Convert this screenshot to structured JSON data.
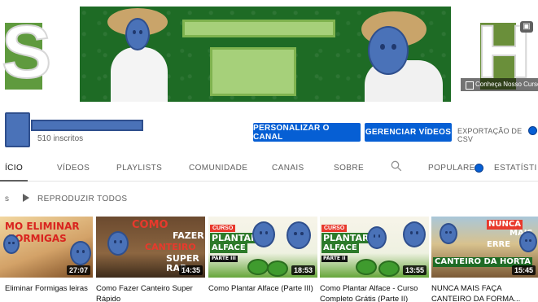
{
  "banner": {
    "left_letter": "S",
    "right_letter": "H",
    "link_text": "Conheça Nosso Curso",
    "camera_icon": "camera-icon"
  },
  "channel": {
    "subscribers": "510 inscritos"
  },
  "actions": {
    "customize_label": "PERSONALIZAR O CANAL",
    "manage_label": "GERENCIAR VÍDEOS",
    "export_label": "EXPORTAÇÃO DE CSV"
  },
  "tabs": [
    "INÍCIO",
    "VÍDEOS",
    "PLAYLISTS",
    "COMUNIDADE",
    "CANAIS",
    "SOBRE"
  ],
  "tabs_display": {
    "inicio_visible": "ÍCIO"
  },
  "tabs_right": {
    "popular_label": "POPULARES",
    "stats_label": "ESTATÍSTI"
  },
  "playlist_row": {
    "prefix": "s",
    "play_all_label": "REPRODUZIR TODOS"
  },
  "videos": [
    {
      "title": "Eliminar Formigas leiras",
      "duration": "27:07",
      "thumb_text": [
        "MO ELIMINAR",
        "FORMIGAS"
      ]
    },
    {
      "title": "Como Fazer Canteiro Super Rápido",
      "duration": "14:35",
      "thumb_text": [
        "COMO",
        "FAZER",
        "CANTEIRO",
        "SUPER",
        "RAP"
      ]
    },
    {
      "title": "Como Plantar Alface (Parte III)",
      "duration": "18:53",
      "thumb_text": [
        "PLANTAR",
        "ALFACE",
        "PARTE III"
      ]
    },
    {
      "title": "Como Plantar Alface - Curso Completo Grátis (Parte II)",
      "duration": "13:55",
      "thumb_text": [
        "PLANTAR",
        "ALFACE",
        "PARTE II"
      ]
    },
    {
      "title": "NUNCA MAIS FAÇA CANTEIRO DA FORMA...",
      "duration": "15:45",
      "thumb_text": [
        "NUNCA",
        "MAIS",
        "ERRE",
        "CANTEIRO DA HORTA"
      ]
    }
  ]
}
